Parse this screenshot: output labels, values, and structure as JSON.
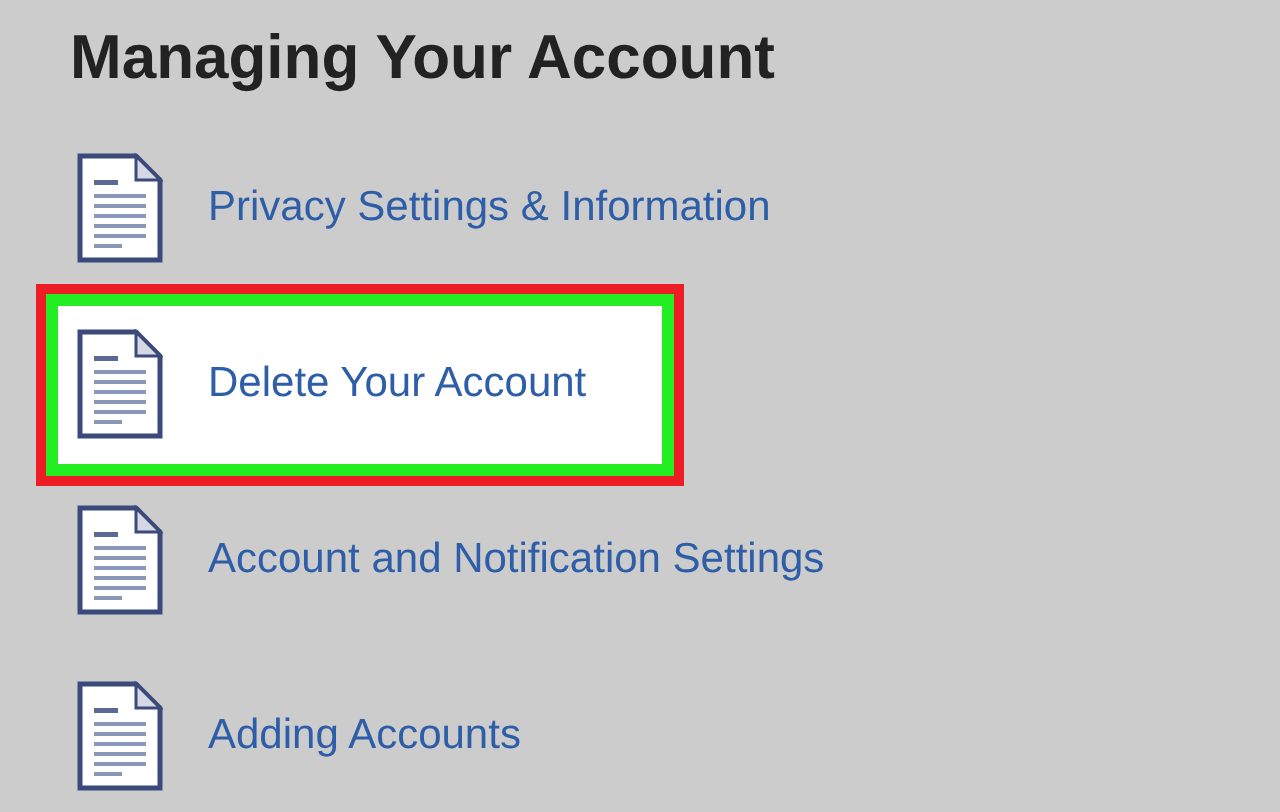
{
  "heading": "Managing Your Account",
  "items": [
    {
      "label": "Privacy Settings & Information",
      "selected": false
    },
    {
      "label": "Delete Your Account",
      "selected": true
    },
    {
      "label": "Account and Notification Settings",
      "selected": false
    },
    {
      "label": "Adding Accounts",
      "selected": false
    }
  ]
}
